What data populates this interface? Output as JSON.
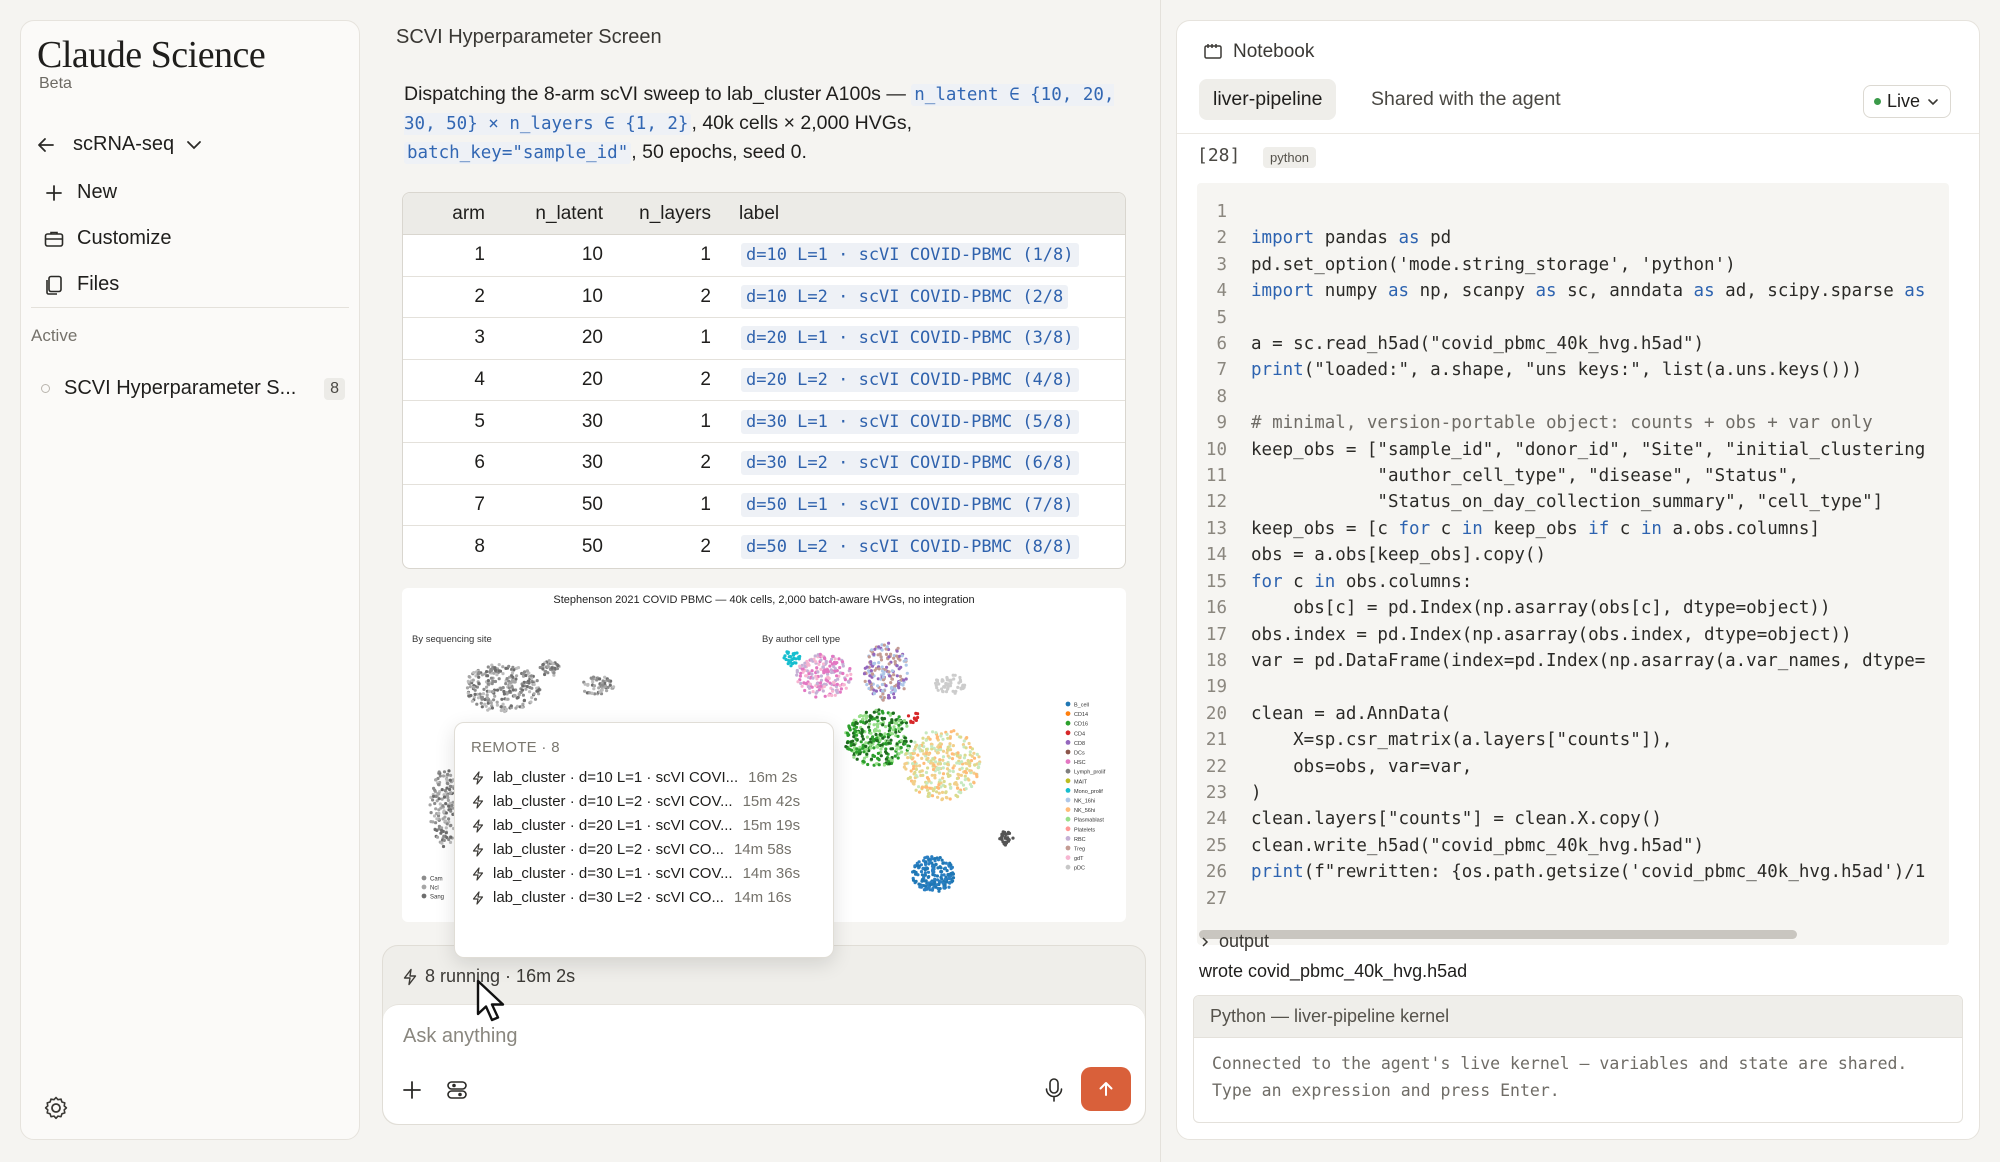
{
  "sidebar": {
    "brand": "Claude Science",
    "brand_sub": "Beta",
    "project": "scRNA-seq",
    "items": [
      {
        "label": "New",
        "icon": "plus-icon"
      },
      {
        "label": "Customize",
        "icon": "briefcase-icon"
      },
      {
        "label": "Files",
        "icon": "files-icon"
      }
    ],
    "active_section_label": "Active",
    "active_item": {
      "label": "SCVI Hyperparameter S...",
      "badge": "8"
    }
  },
  "thread": {
    "title": "SCVI Hyperparameter Screen",
    "message": {
      "p1": "Dispatching the 8-arm scVI sweep to lab_cluster A100s — ",
      "code1": "n_latent ∈ {10, 20, 30, 50} × n_layers ∈ {1, 2}",
      "p2": ", 40k cells × 2,000 HVGs, ",
      "code2": "batch_key=\"sample_id\"",
      "p3": ", 50 epochs, seed 0."
    },
    "table": {
      "headers": [
        "arm",
        "n_latent",
        "n_layers",
        "label"
      ],
      "rows": [
        {
          "arm": "1",
          "n_latent": "10",
          "n_layers": "1",
          "label": "d=10 L=1 · scVI COVID-PBMC (1/8)"
        },
        {
          "arm": "2",
          "n_latent": "10",
          "n_layers": "2",
          "label": "d=10 L=2 · scVI COVID-PBMC (2/8"
        },
        {
          "arm": "3",
          "n_latent": "20",
          "n_layers": "1",
          "label": "d=20 L=1 · scVI COVID-PBMC (3/8)"
        },
        {
          "arm": "4",
          "n_latent": "20",
          "n_layers": "2",
          "label": "d=20 L=2 · scVI COVID-PBMC (4/8)"
        },
        {
          "arm": "5",
          "n_latent": "30",
          "n_layers": "1",
          "label": "d=30 L=1 · scVI COVID-PBMC (5/8)"
        },
        {
          "arm": "6",
          "n_latent": "30",
          "n_layers": "2",
          "label": "d=30 L=2 · scVI COVID-PBMC (6/8)"
        },
        {
          "arm": "7",
          "n_latent": "50",
          "n_layers": "1",
          "label": "d=50 L=1 · scVI COVID-PBMC (7/8)"
        },
        {
          "arm": "8",
          "n_latent": "50",
          "n_layers": "2",
          "label": "d=50 L=2 · scVI COVID-PBMC (8/8)"
        }
      ]
    },
    "figure": {
      "title": "Stephenson 2021 COVID PBMC — 40k cells, 2,000 batch-aware HVGs, no integration",
      "left_subtitle": "By sequencing site",
      "right_subtitle": "By author cell type",
      "left_legend": [
        "Cam",
        "Ncl",
        "Sang"
      ],
      "right_legend": [
        "B_cell",
        "CD14",
        "CD16",
        "CD4",
        "CD8",
        "DCs",
        "HSC",
        "Lymph_prolif",
        "MAIT",
        "Mono_prolif",
        "NK_16hi",
        "NK_56hi",
        "Plasmablast",
        "Platelets",
        "RBC",
        "Treg",
        "gdT",
        "pDC"
      ]
    },
    "remote": {
      "header": "REMOTE · 8",
      "jobs": [
        {
          "label": "lab_cluster · d=10 L=1 · scVI COVI...",
          "duration": "16m 2s"
        },
        {
          "label": "lab_cluster · d=10 L=2 · scVI COV...",
          "duration": "15m 42s"
        },
        {
          "label": "lab_cluster · d=20 L=1 · scVI COV...",
          "duration": "15m 19s"
        },
        {
          "label": "lab_cluster · d=20 L=2 · scVI CO...",
          "duration": "14m 58s"
        },
        {
          "label": "lab_cluster · d=30 L=1 · scVI COV...",
          "duration": "14m 36s"
        },
        {
          "label": "lab_cluster · d=30 L=2 · scVI CO...",
          "duration": "14m 16s"
        }
      ]
    },
    "composer": {
      "running": "8 running · 16m 2s",
      "placeholder": "Ask anything"
    }
  },
  "notebook": {
    "header": "Notebook",
    "tabs": [
      "liver-pipeline",
      "Shared with the agent"
    ],
    "live_label": "Live",
    "cell_number": "[28]",
    "cell_lang": "python",
    "code_lines": [
      "",
      "import pandas as pd",
      "pd.set_option('mode.string_storage', 'python')",
      "import numpy as np, scanpy as sc, anndata as ad, scipy.sparse as",
      "",
      "a = sc.read_h5ad(\"covid_pbmc_40k_hvg.h5ad\")",
      "print(\"loaded:\", a.shape, \"uns keys:\", list(a.uns.keys()))",
      "",
      "# minimal, version-portable object: counts + obs + var only",
      "keep_obs = [\"sample_id\", \"donor_id\", \"Site\", \"initial_clustering",
      "            \"author_cell_type\", \"disease\", \"Status\",",
      "            \"Status_on_day_collection_summary\", \"cell_type\"]",
      "keep_obs = [c for c in keep_obs if c in a.obs.columns]",
      "obs = a.obs[keep_obs].copy()",
      "for c in obs.columns:",
      "    obs[c] = pd.Index(np.asarray(obs[c], dtype=object))",
      "obs.index = pd.Index(np.asarray(obs.index, dtype=object))",
      "var = pd.DataFrame(index=pd.Index(np.asarray(a.var_names, dtype=",
      "",
      "clean = ad.AnnData(",
      "    X=sp.csr_matrix(a.layers[\"counts\"]),",
      "    obs=obs, var=var,",
      ")",
      "clean.layers[\"counts\"] = clean.X.copy()",
      "clean.write_h5ad(\"covid_pbmc_40k_hvg.h5ad\")",
      "print(f\"rewritten: {os.path.getsize('covid_pbmc_40k_hvg.h5ad')/1",
      ""
    ],
    "output_label": "output",
    "output_text": "wrote covid_pbmc_40k_hvg.h5ad",
    "kernel_title": "Python — liver-pipeline kernel",
    "kernel_message": "Connected to the agent's live kernel — variables and state are shared. Type an expression and press Enter."
  },
  "colors": {
    "accent_send": "#d9603a",
    "code_link": "#2f62ad",
    "live_dot": "#3b9a4a"
  }
}
